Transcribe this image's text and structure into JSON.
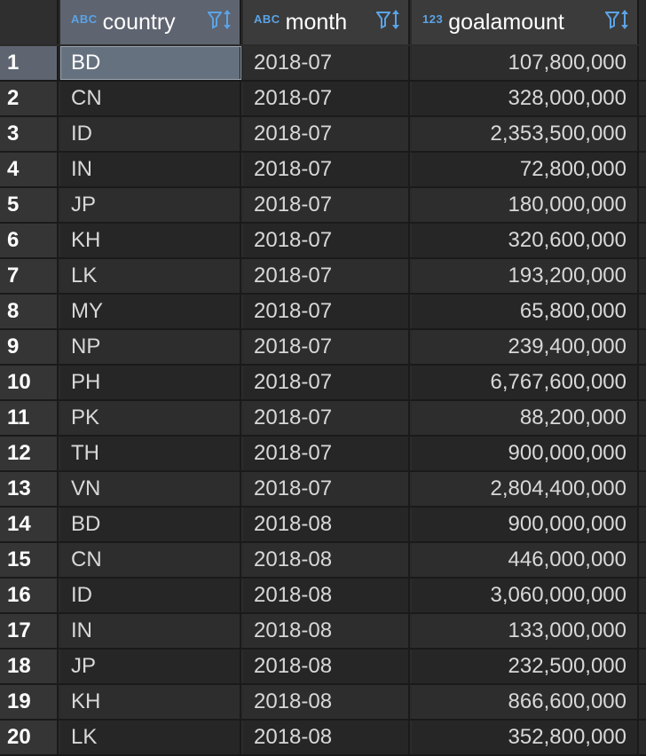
{
  "columns": [
    {
      "type_label": "ABC",
      "name": "country"
    },
    {
      "type_label": "ABC",
      "name": "month"
    },
    {
      "type_label": "123",
      "name": "goalamount"
    }
  ],
  "accent_color": "#5ba3e6",
  "selected_color": "#66717f",
  "rows": [
    {
      "n": "1",
      "country": "BD",
      "month": "2018-07",
      "goalamount": "107,800,000"
    },
    {
      "n": "2",
      "country": "CN",
      "month": "2018-07",
      "goalamount": "328,000,000"
    },
    {
      "n": "3",
      "country": "ID",
      "month": "2018-07",
      "goalamount": "2,353,500,000"
    },
    {
      "n": "4",
      "country": "IN",
      "month": "2018-07",
      "goalamount": "72,800,000"
    },
    {
      "n": "5",
      "country": "JP",
      "month": "2018-07",
      "goalamount": "180,000,000"
    },
    {
      "n": "6",
      "country": "KH",
      "month": "2018-07",
      "goalamount": "320,600,000"
    },
    {
      "n": "7",
      "country": "LK",
      "month": "2018-07",
      "goalamount": "193,200,000"
    },
    {
      "n": "8",
      "country": "MY",
      "month": "2018-07",
      "goalamount": "65,800,000"
    },
    {
      "n": "9",
      "country": "NP",
      "month": "2018-07",
      "goalamount": "239,400,000"
    },
    {
      "n": "10",
      "country": "PH",
      "month": "2018-07",
      "goalamount": "6,767,600,000"
    },
    {
      "n": "11",
      "country": "PK",
      "month": "2018-07",
      "goalamount": "88,200,000"
    },
    {
      "n": "12",
      "country": "TH",
      "month": "2018-07",
      "goalamount": "900,000,000"
    },
    {
      "n": "13",
      "country": "VN",
      "month": "2018-07",
      "goalamount": "2,804,400,000"
    },
    {
      "n": "14",
      "country": "BD",
      "month": "2018-08",
      "goalamount": "900,000,000"
    },
    {
      "n": "15",
      "country": "CN",
      "month": "2018-08",
      "goalamount": "446,000,000"
    },
    {
      "n": "16",
      "country": "ID",
      "month": "2018-08",
      "goalamount": "3,060,000,000"
    },
    {
      "n": "17",
      "country": "IN",
      "month": "2018-08",
      "goalamount": "133,000,000"
    },
    {
      "n": "18",
      "country": "JP",
      "month": "2018-08",
      "goalamount": "232,500,000"
    },
    {
      "n": "19",
      "country": "KH",
      "month": "2018-08",
      "goalamount": "866,600,000"
    },
    {
      "n": "20",
      "country": "LK",
      "month": "2018-08",
      "goalamount": "352,800,000"
    }
  ]
}
